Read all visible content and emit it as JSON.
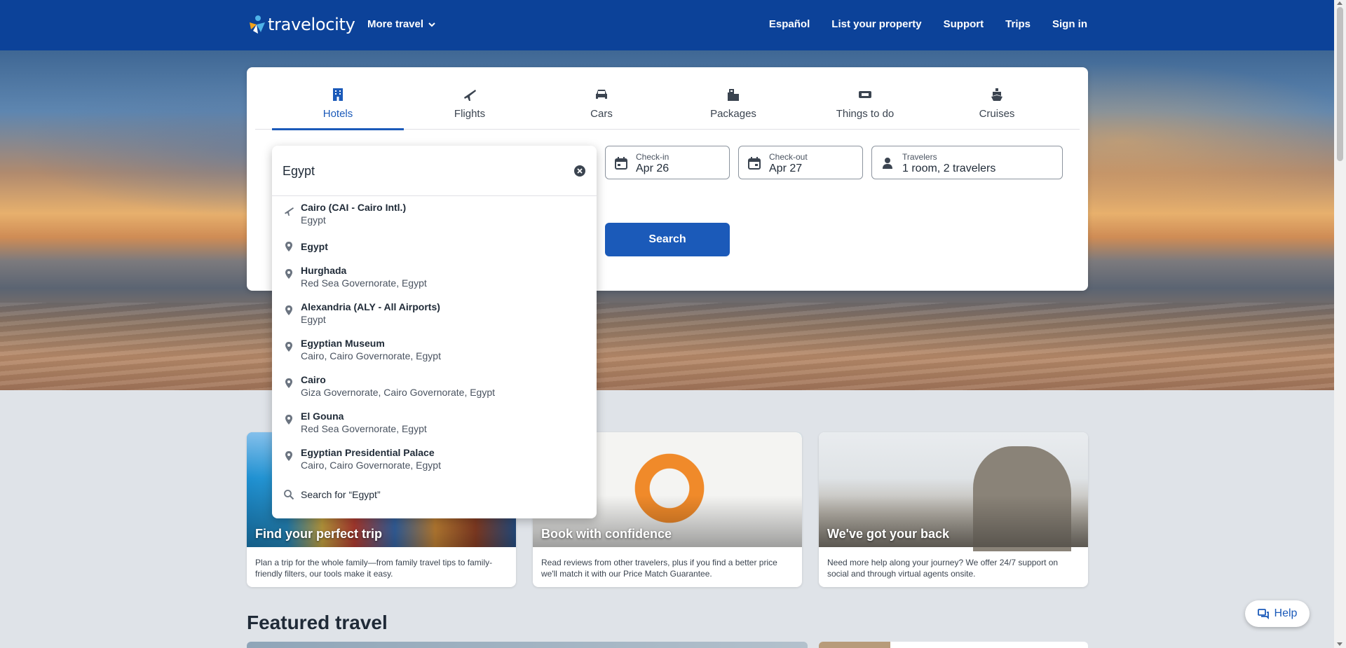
{
  "header": {
    "brand": "travelocity",
    "more_travel": "More travel",
    "nav": [
      "Español",
      "List your property",
      "Support",
      "Trips",
      "Sign in"
    ]
  },
  "search_card": {
    "tabs": [
      {
        "label": "Hotels",
        "icon": "building-icon",
        "active": true
      },
      {
        "label": "Flights",
        "icon": "plane-icon",
        "active": false
      },
      {
        "label": "Cars",
        "icon": "car-icon",
        "active": false
      },
      {
        "label": "Packages",
        "icon": "packages-icon",
        "active": false
      },
      {
        "label": "Things to do",
        "icon": "ticket-icon",
        "active": false
      },
      {
        "label": "Cruises",
        "icon": "cruise-icon",
        "active": false
      }
    ],
    "checkin": {
      "label": "Check-in",
      "value": "Apr 26"
    },
    "checkout": {
      "label": "Check-out",
      "value": "Apr 27"
    },
    "travelers": {
      "label": "Travelers",
      "value": "1 room, 2 travelers"
    },
    "search_button": "Search"
  },
  "autocomplete": {
    "query": "Egypt",
    "items": [
      {
        "title": "Cairo (CAI - Cairo Intl.)",
        "subtitle": "Egypt",
        "icon": "plane-icon"
      },
      {
        "title": "Egypt",
        "subtitle": "",
        "icon": "pin-icon"
      },
      {
        "title": "Hurghada",
        "subtitle": "Red Sea Governorate, Egypt",
        "icon": "pin-icon"
      },
      {
        "title": "Alexandria (ALY - All Airports)",
        "subtitle": "Egypt",
        "icon": "pin-icon"
      },
      {
        "title": "Egyptian Museum",
        "subtitle": "Cairo, Cairo Governorate, Egypt",
        "icon": "pin-icon"
      },
      {
        "title": "Cairo",
        "subtitle": "Giza Governorate, Cairo Governorate, Egypt",
        "icon": "pin-icon"
      },
      {
        "title": "El Gouna",
        "subtitle": "Red Sea Governorate, Egypt",
        "icon": "pin-icon"
      },
      {
        "title": "Egyptian Presidential Palace",
        "subtitle": "Cairo, Cairo Governorate, Egypt",
        "icon": "pin-icon"
      }
    ],
    "search_for": "Search for “Egypt”"
  },
  "features": [
    {
      "title": "Find your perfect trip",
      "description": "Plan a trip for the whole family—from family travel tips to family-friendly filters, our tools make it easy."
    },
    {
      "title": "Book with confidence",
      "description": "Read reviews from other travelers, plus if you find a better price we'll match it with our Price Match Guarantee."
    },
    {
      "title": "We've got your back",
      "description": "Need more help along your journey? We offer 24/7 support on social and through virtual agents onsite."
    }
  ],
  "featured_travel_title": "Featured travel",
  "help_button": "Help",
  "colors": {
    "brand_blue": "#0c4299",
    "accent_blue": "#1b5ab9"
  }
}
